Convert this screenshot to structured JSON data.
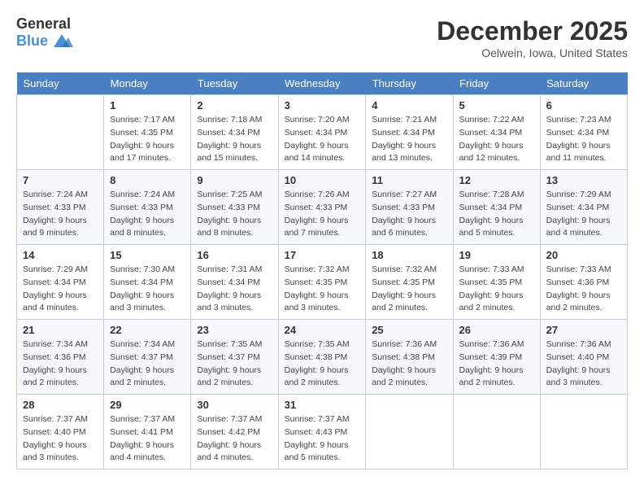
{
  "header": {
    "logo_general": "General",
    "logo_blue": "Blue",
    "month": "December 2025",
    "location": "Oelwein, Iowa, United States"
  },
  "days_of_week": [
    "Sunday",
    "Monday",
    "Tuesday",
    "Wednesday",
    "Thursday",
    "Friday",
    "Saturday"
  ],
  "weeks": [
    [
      {
        "day": "",
        "info": ""
      },
      {
        "day": "1",
        "info": "Sunrise: 7:17 AM\nSunset: 4:35 PM\nDaylight: 9 hours\nand 17 minutes."
      },
      {
        "day": "2",
        "info": "Sunrise: 7:18 AM\nSunset: 4:34 PM\nDaylight: 9 hours\nand 15 minutes."
      },
      {
        "day": "3",
        "info": "Sunrise: 7:20 AM\nSunset: 4:34 PM\nDaylight: 9 hours\nand 14 minutes."
      },
      {
        "day": "4",
        "info": "Sunrise: 7:21 AM\nSunset: 4:34 PM\nDaylight: 9 hours\nand 13 minutes."
      },
      {
        "day": "5",
        "info": "Sunrise: 7:22 AM\nSunset: 4:34 PM\nDaylight: 9 hours\nand 12 minutes."
      },
      {
        "day": "6",
        "info": "Sunrise: 7:23 AM\nSunset: 4:34 PM\nDaylight: 9 hours\nand 11 minutes."
      }
    ],
    [
      {
        "day": "7",
        "info": "Sunrise: 7:24 AM\nSunset: 4:33 PM\nDaylight: 9 hours\nand 9 minutes."
      },
      {
        "day": "8",
        "info": "Sunrise: 7:24 AM\nSunset: 4:33 PM\nDaylight: 9 hours\nand 8 minutes."
      },
      {
        "day": "9",
        "info": "Sunrise: 7:25 AM\nSunset: 4:33 PM\nDaylight: 9 hours\nand 8 minutes."
      },
      {
        "day": "10",
        "info": "Sunrise: 7:26 AM\nSunset: 4:33 PM\nDaylight: 9 hours\nand 7 minutes."
      },
      {
        "day": "11",
        "info": "Sunrise: 7:27 AM\nSunset: 4:33 PM\nDaylight: 9 hours\nand 6 minutes."
      },
      {
        "day": "12",
        "info": "Sunrise: 7:28 AM\nSunset: 4:34 PM\nDaylight: 9 hours\nand 5 minutes."
      },
      {
        "day": "13",
        "info": "Sunrise: 7:29 AM\nSunset: 4:34 PM\nDaylight: 9 hours\nand 4 minutes."
      }
    ],
    [
      {
        "day": "14",
        "info": "Sunrise: 7:29 AM\nSunset: 4:34 PM\nDaylight: 9 hours\nand 4 minutes."
      },
      {
        "day": "15",
        "info": "Sunrise: 7:30 AM\nSunset: 4:34 PM\nDaylight: 9 hours\nand 3 minutes."
      },
      {
        "day": "16",
        "info": "Sunrise: 7:31 AM\nSunset: 4:34 PM\nDaylight: 9 hours\nand 3 minutes."
      },
      {
        "day": "17",
        "info": "Sunrise: 7:32 AM\nSunset: 4:35 PM\nDaylight: 9 hours\nand 3 minutes."
      },
      {
        "day": "18",
        "info": "Sunrise: 7:32 AM\nSunset: 4:35 PM\nDaylight: 9 hours\nand 2 minutes."
      },
      {
        "day": "19",
        "info": "Sunrise: 7:33 AM\nSunset: 4:35 PM\nDaylight: 9 hours\nand 2 minutes."
      },
      {
        "day": "20",
        "info": "Sunrise: 7:33 AM\nSunset: 4:36 PM\nDaylight: 9 hours\nand 2 minutes."
      }
    ],
    [
      {
        "day": "21",
        "info": "Sunrise: 7:34 AM\nSunset: 4:36 PM\nDaylight: 9 hours\nand 2 minutes."
      },
      {
        "day": "22",
        "info": "Sunrise: 7:34 AM\nSunset: 4:37 PM\nDaylight: 9 hours\nand 2 minutes."
      },
      {
        "day": "23",
        "info": "Sunrise: 7:35 AM\nSunset: 4:37 PM\nDaylight: 9 hours\nand 2 minutes."
      },
      {
        "day": "24",
        "info": "Sunrise: 7:35 AM\nSunset: 4:38 PM\nDaylight: 9 hours\nand 2 minutes."
      },
      {
        "day": "25",
        "info": "Sunrise: 7:36 AM\nSunset: 4:38 PM\nDaylight: 9 hours\nand 2 minutes."
      },
      {
        "day": "26",
        "info": "Sunrise: 7:36 AM\nSunset: 4:39 PM\nDaylight: 9 hours\nand 2 minutes."
      },
      {
        "day": "27",
        "info": "Sunrise: 7:36 AM\nSunset: 4:40 PM\nDaylight: 9 hours\nand 3 minutes."
      }
    ],
    [
      {
        "day": "28",
        "info": "Sunrise: 7:37 AM\nSunset: 4:40 PM\nDaylight: 9 hours\nand 3 minutes."
      },
      {
        "day": "29",
        "info": "Sunrise: 7:37 AM\nSunset: 4:41 PM\nDaylight: 9 hours\nand 4 minutes."
      },
      {
        "day": "30",
        "info": "Sunrise: 7:37 AM\nSunset: 4:42 PM\nDaylight: 9 hours\nand 4 minutes."
      },
      {
        "day": "31",
        "info": "Sunrise: 7:37 AM\nSunset: 4:43 PM\nDaylight: 9 hours\nand 5 minutes."
      },
      {
        "day": "",
        "info": ""
      },
      {
        "day": "",
        "info": ""
      },
      {
        "day": "",
        "info": ""
      }
    ]
  ]
}
